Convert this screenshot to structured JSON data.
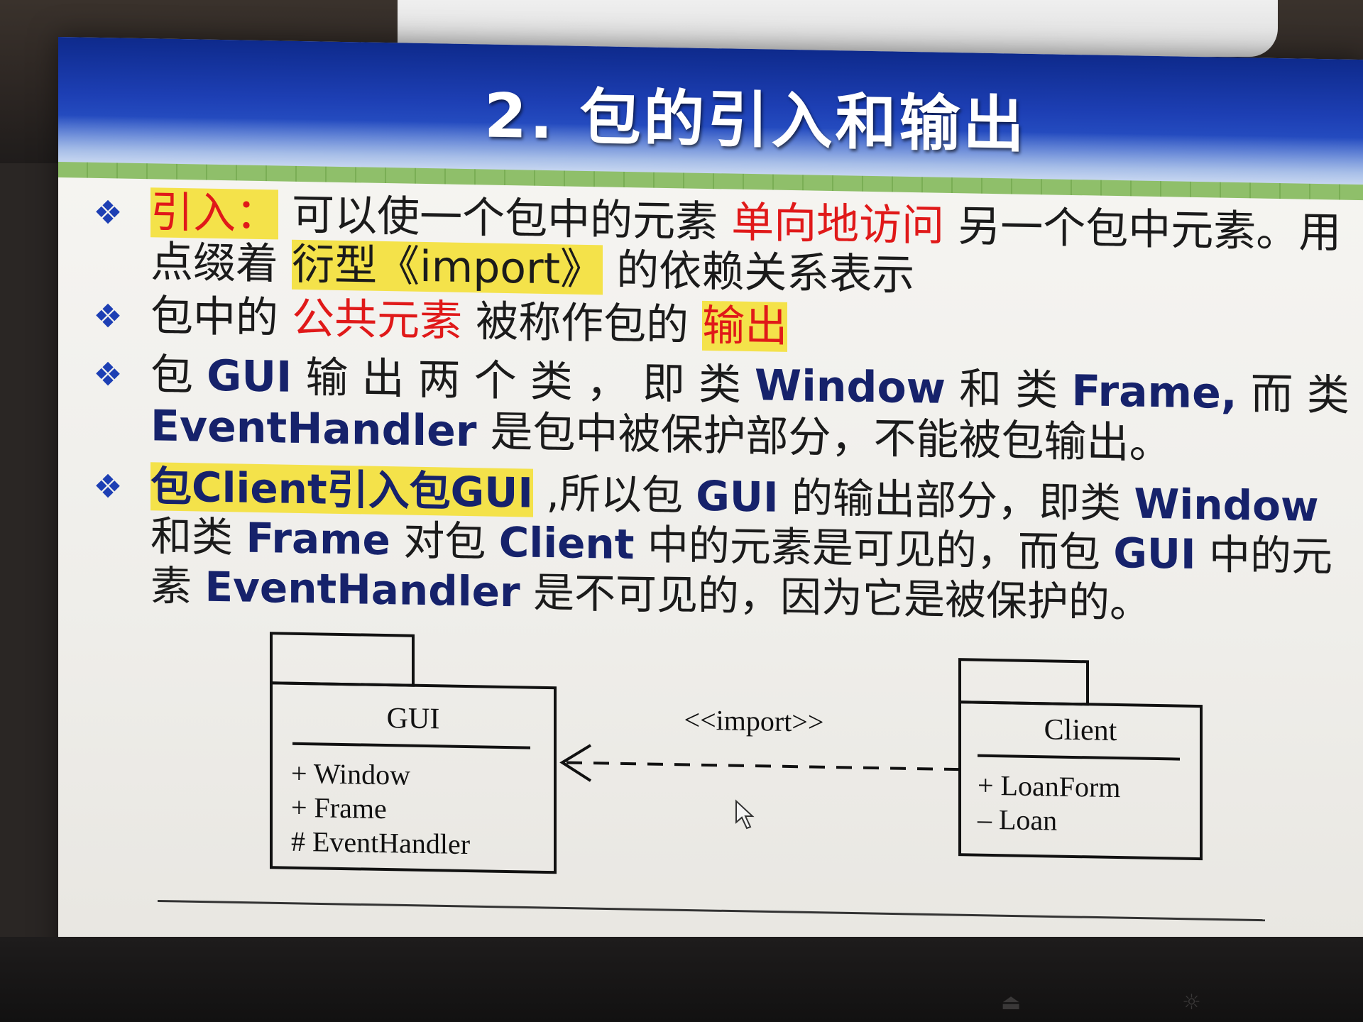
{
  "slide": {
    "title": "2. 包的引入和输出",
    "bullets": {
      "b1": {
        "term": "引入：",
        "text1": "可以使一个包中的元素",
        "red": "单向地访问",
        "text2": "另一个包中元素。用点缀着",
        "hl": "衍型《import》",
        "text3": "的依赖关系表示"
      },
      "b2": {
        "text1": "包中的",
        "red": "公共元素",
        "text2": "被称作包的",
        "hl": "输出"
      },
      "b3": {
        "t1": "包 ",
        "k1": "GUI",
        "t2": " 输 出 两 个 类 ， 即 类 ",
        "k2": "Window",
        "t3": " 和 类 ",
        "k3": "Frame,",
        "t4": " 而 类 ",
        "k4": "EventHandler",
        "t5": "是包中被保护部分，不能被包输出。"
      },
      "b4": {
        "hl": "包Client引入包GUI",
        "t1": ",所以包",
        "k1": "GUI",
        "t2": "的输出部分，即类 ",
        "k2": "Window",
        "t3": " 和类 ",
        "k3": "Frame",
        "t4": " 对包 ",
        "k4": "Client",
        "t5": " 中的元素是可见的，而包 ",
        "k5": "GUI",
        "t6": " 中的元素",
        "k6": "EventHandler",
        "t7": "是不可见的，因为它是被保护的。"
      }
    },
    "diagram": {
      "gui": {
        "name": "GUI",
        "items": [
          "+ Window",
          "+ Frame",
          "# EventHandler"
        ]
      },
      "client": {
        "name": "Client",
        "items": [
          "+ LoanForm",
          "– Loan"
        ]
      },
      "dependency_label": "<<import>>"
    }
  },
  "colors": {
    "banner": "#1d3fb4",
    "highlight": "#f4e24a",
    "red": "#e01919",
    "navy": "#16226b"
  }
}
